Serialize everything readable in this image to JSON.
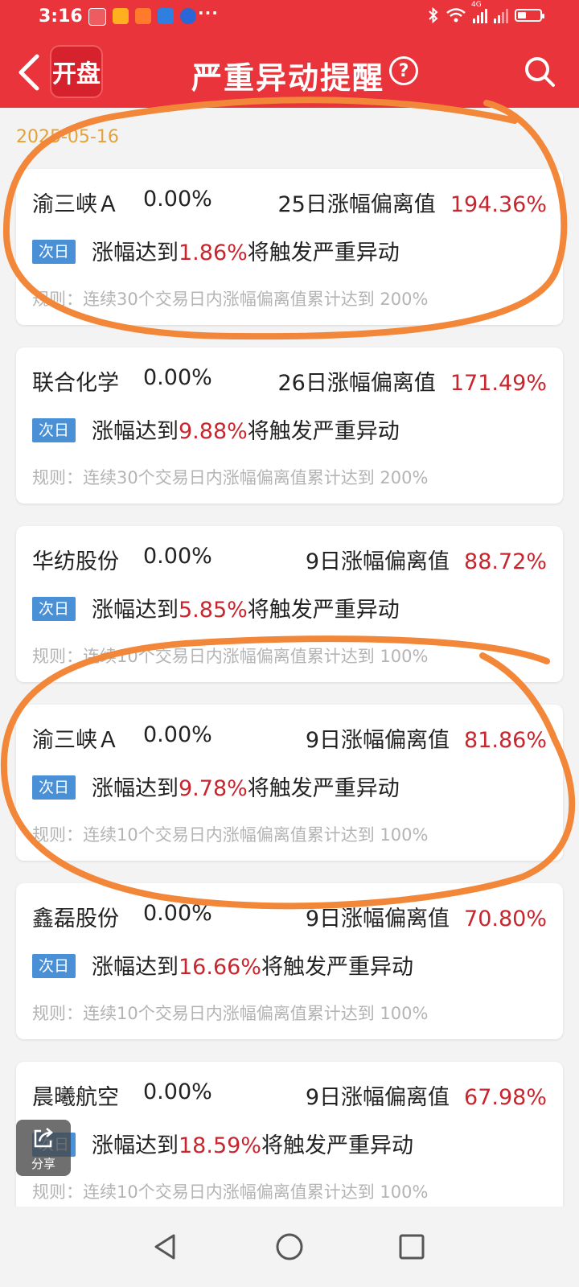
{
  "status_bar": {
    "time": "3:16",
    "icons": [
      "app-notification-icon",
      "weibo-icon",
      "video-app-icon",
      "weather-icon",
      "browser-icon",
      "more-dots-icon",
      "bluetooth-icon",
      "wifi-icon",
      "signal-4g-icon",
      "signal-icon",
      "battery-icon"
    ],
    "dots": "···",
    "network": "4G",
    "battery_level": 0.4
  },
  "nav": {
    "logo_text": "开盘",
    "title": "严重异动提醒",
    "help": "?"
  },
  "date": "2025-05-16",
  "tag_label": "次日",
  "alerts": [
    {
      "name": "渝三峡Ａ",
      "change": "0.00%",
      "metric_label": "25日涨幅偏离值",
      "metric_value": "194.36%",
      "trigger_prefix": "涨幅达到",
      "trigger_value": "1.86%",
      "trigger_suffix": "将触发严重异动",
      "rule": "规则：连续30个交易日内涨幅偏离值累计达到 200%"
    },
    {
      "name": "联合化学",
      "change": "0.00%",
      "metric_label": "26日涨幅偏离值",
      "metric_value": "171.49%",
      "trigger_prefix": "涨幅达到",
      "trigger_value": "9.88%",
      "trigger_suffix": "将触发严重异动",
      "rule": "规则：连续30个交易日内涨幅偏离值累计达到 200%"
    },
    {
      "name": "华纺股份",
      "change": "0.00%",
      "metric_label": "9日涨幅偏离值",
      "metric_value": "88.72%",
      "trigger_prefix": "涨幅达到",
      "trigger_value": "5.85%",
      "trigger_suffix": "将触发严重异动",
      "rule": "规则：连续10个交易日内涨幅偏离值累计达到 100%"
    },
    {
      "name": "渝三峡Ａ",
      "change": "0.00%",
      "metric_label": "9日涨幅偏离值",
      "metric_value": "81.86%",
      "trigger_prefix": "涨幅达到",
      "trigger_value": "9.78%",
      "trigger_suffix": "将触发严重异动",
      "rule": "规则：连续10个交易日内涨幅偏离值累计达到 100%"
    },
    {
      "name": "鑫磊股份",
      "change": "0.00%",
      "metric_label": "9日涨幅偏离值",
      "metric_value": "70.80%",
      "trigger_prefix": "涨幅达到",
      "trigger_value": "16.66%",
      "trigger_suffix": "将触发严重异动",
      "rule": "规则：连续10个交易日内涨幅偏离值累计达到 100%"
    },
    {
      "name": "晨曦航空",
      "change": "0.00%",
      "metric_label": "9日涨幅偏离值",
      "metric_value": "67.98%",
      "trigger_prefix": "涨幅达到",
      "trigger_value": "18.59%",
      "trigger_suffix": "将触发严重异动",
      "rule": "规则：连续10个交易日内涨幅偏离值累计达到 100%"
    }
  ],
  "share_label": "分享",
  "bottom_nav": [
    "back-triangle-icon",
    "home-circle-icon",
    "recents-square-icon"
  ],
  "colors": {
    "header_red": "#e8343a",
    "value_red": "#c8262e",
    "tag_blue": "#4a90d6",
    "date_gold": "#e3a23a",
    "annotation_orange": "#f2873a",
    "background": "#f3f3f3"
  }
}
